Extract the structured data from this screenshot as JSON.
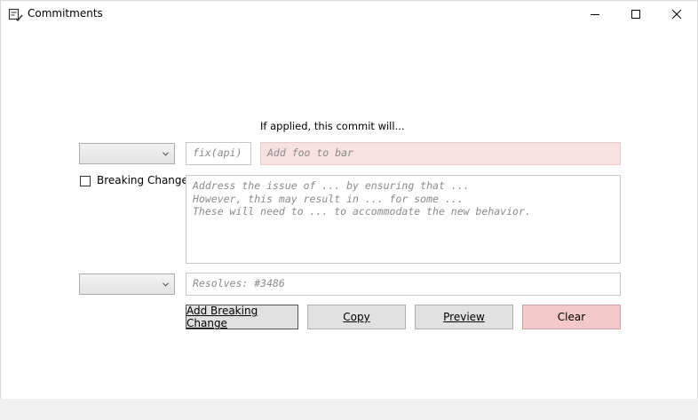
{
  "window": {
    "title": "Commitments"
  },
  "form": {
    "heading": "If applied, this commit will...",
    "type_select": {
      "value": ""
    },
    "scope_input": {
      "placeholder": "fix(api)"
    },
    "summary_input": {
      "placeholder": "Add foo to bar"
    },
    "breaking_change": {
      "label": "Breaking Change",
      "checked": false
    },
    "body_input": {
      "placeholder": "Address the issue of ... by ensuring that ...\nHowever, this may result in ... for some ...\nThese will need to ... to accommodate the new behavior."
    },
    "footer_select": {
      "value": ""
    },
    "footer_input": {
      "placeholder": "Resolves: #3486"
    }
  },
  "buttons": {
    "add_breaking_change": "Add Breaking Change",
    "copy": "Copy",
    "preview": "Preview",
    "clear": "Clear"
  },
  "colors": {
    "summary_bg": "#f8e1e1",
    "clear_bg": "#f4c9c9"
  }
}
